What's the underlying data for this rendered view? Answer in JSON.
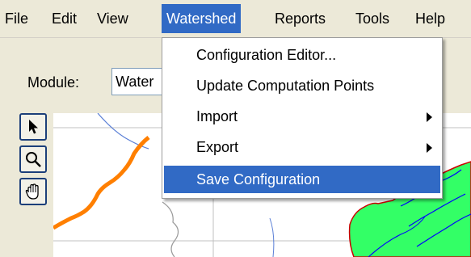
{
  "menubar": {
    "items": [
      {
        "label": "File"
      },
      {
        "label": "Edit"
      },
      {
        "label": "View"
      },
      {
        "label": "Watershed"
      },
      {
        "label": "Reports"
      },
      {
        "label": "Tools"
      },
      {
        "label": "Help"
      }
    ],
    "active_index": 3
  },
  "module": {
    "label": "Module:",
    "value": "Water"
  },
  "toolbox": {
    "tools": [
      {
        "name": "select",
        "icon": "pointer-arrow-icon"
      },
      {
        "name": "zoom",
        "icon": "magnifier-icon"
      },
      {
        "name": "pan",
        "icon": "hand-icon"
      }
    ]
  },
  "watershed_menu": {
    "items": [
      {
        "label": "Configuration Editor...",
        "submenu": false
      },
      {
        "label": "Update Computation Points",
        "submenu": false
      },
      {
        "label": "Import",
        "submenu": true
      },
      {
        "label": "Export",
        "submenu": true
      },
      {
        "label": "Save Configuration",
        "submenu": false,
        "highlighted": true
      }
    ]
  },
  "colors": {
    "highlight": "#316ac5",
    "stream": "#ff7f00",
    "basin_fill": "#33ff66",
    "basin_border": "#cc0000",
    "river": "#0000ff"
  }
}
